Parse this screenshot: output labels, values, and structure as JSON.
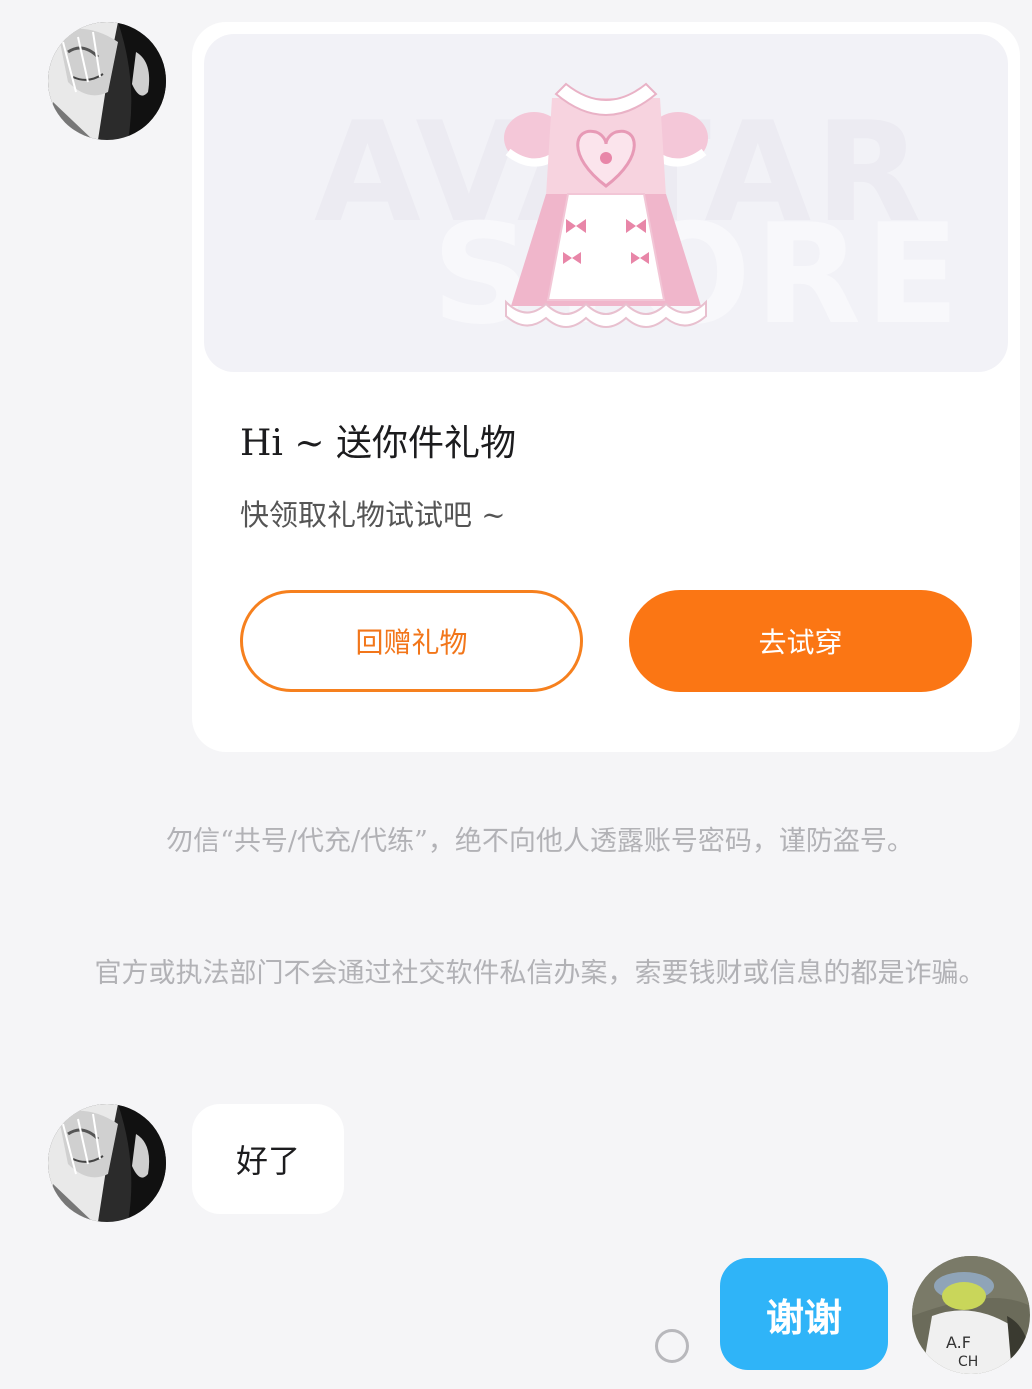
{
  "messages": {
    "gift_card": {
      "sender_avatar": "manga-avatar",
      "image_watermark": [
        "AVATAR",
        "STORE"
      ],
      "image_item": "pink-lolita-dress",
      "title": "Hi ~ 送你件礼物",
      "subtitle": "快领取礼物试试吧 ~",
      "return_gift_label": "回赠礼物",
      "try_on_label": "去试穿",
      "colors": {
        "accent": "#fb7614",
        "accent_border": "#f6801e"
      }
    },
    "system_notices": [
      "勿信“共号/代充/代练”，绝不向他人透露账号密码，谨防盗号。",
      "官方或执法部门不会通过社交软件私信办案，索要钱财或信息的都是诈骗。"
    ],
    "incoming_reply": {
      "sender_avatar": "manga-avatar",
      "text": "好了"
    },
    "outgoing_reply": {
      "sender_avatar": "user-photo-avatar",
      "text": "谢谢",
      "bubble_color": "#2fb4f8",
      "status_icon": "sending-circle-icon"
    }
  }
}
